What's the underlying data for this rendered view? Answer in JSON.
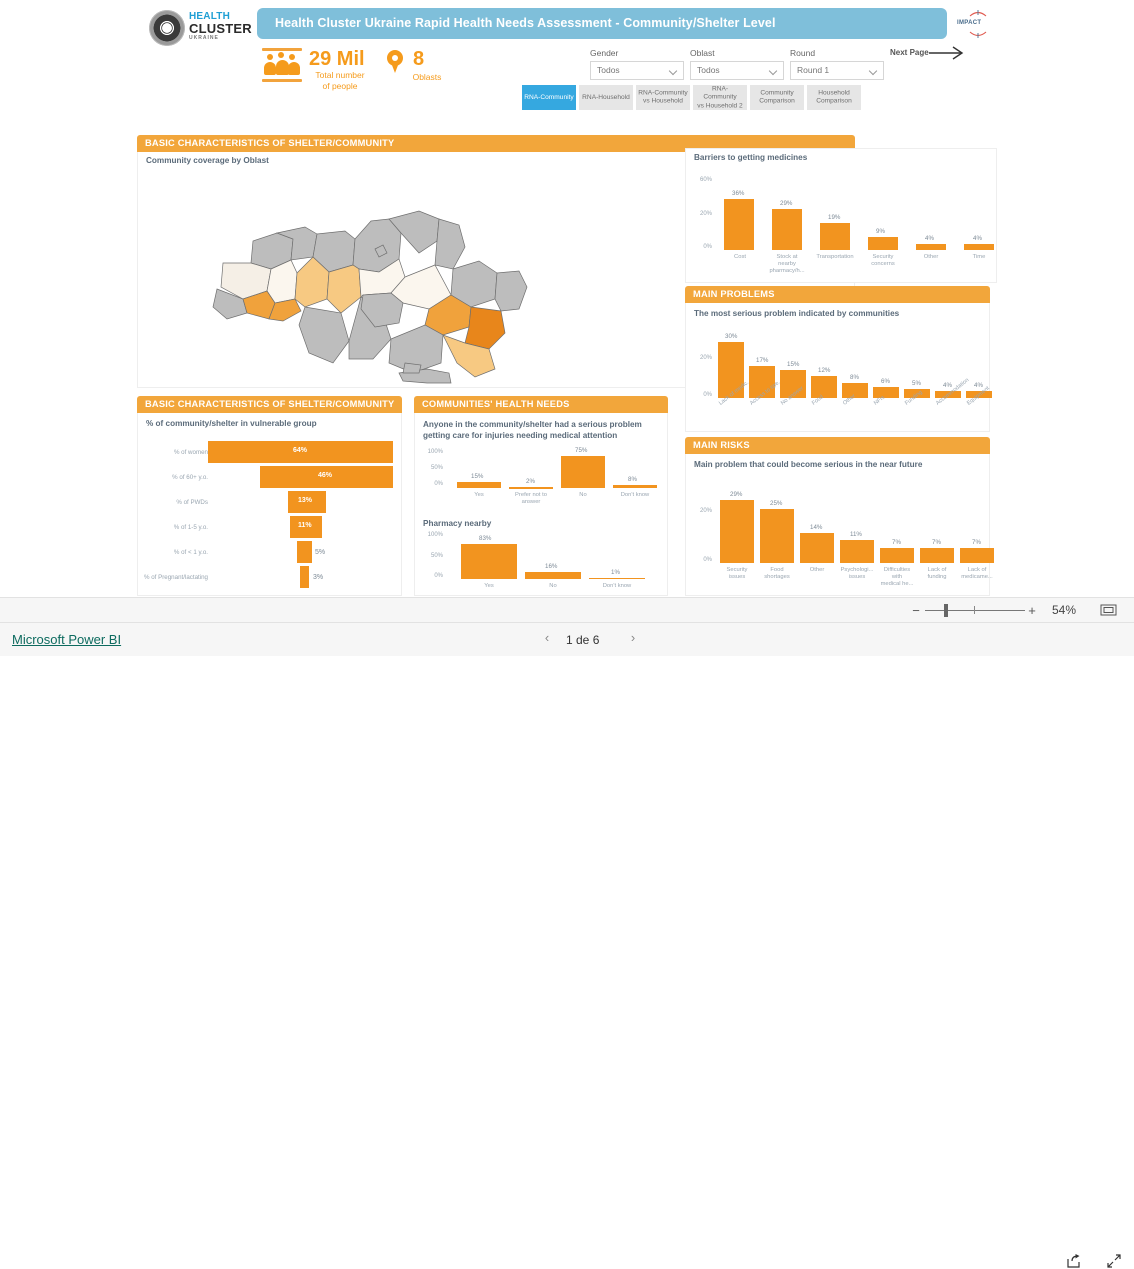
{
  "window": {
    "footer_link": "Microsoft Power BI",
    "page_indicator": "1 de 6",
    "prev_page_icon": "chevron-left-icon",
    "next_page_icon": "chevron-right-icon",
    "zoom_minus": "−",
    "zoom_plus": "+",
    "zoom_level": "54%",
    "fit_icon": "fit-to-page-icon",
    "share_icon": "share-icon",
    "fullscreen_icon": "fullscreen-icon"
  },
  "header": {
    "title": "Health Cluster Ukraine Rapid Health Needs Assessment - Community/Shelter Level",
    "title_bg": "#7fbfda",
    "logo": {
      "line1": "HEALTH",
      "line2": "CLUSTER",
      "line3": "UKRAINE",
      "icon": "health-cluster-sun-logo"
    },
    "partner_logo": "impact-initiatives-logo",
    "next_page_label": "Next Page",
    "next_page_icon": "long-arrow-right-icon"
  },
  "kpis": [
    {
      "value": "29 Mil",
      "label": "Total number\nof people",
      "label_l1": "Total number",
      "label_l2": "of people",
      "icon": "people-group-icon",
      "color": "#F59B1C"
    },
    {
      "value": "8",
      "label": "Oblasts",
      "icon": "map-pin-icon",
      "color": "#F59B1C"
    }
  ],
  "slicers": [
    {
      "label": "Gender",
      "value": "Todos",
      "icon": "chevron-down-icon"
    },
    {
      "label": "Oblast",
      "value": "Todos",
      "icon": "chevron-down-icon"
    },
    {
      "label": "Round",
      "value": "Round 1",
      "icon": "chevron-down-icon"
    }
  ],
  "tabs": [
    {
      "label": "RNA-Community",
      "lines": [
        "RNA-Community"
      ],
      "active": true
    },
    {
      "label": "RNA-Household",
      "lines": [
        "RNA-Household"
      ],
      "active": false
    },
    {
      "label": "RNA-Community vs Household",
      "lines": [
        "RNA-Community",
        "vs Household"
      ],
      "active": false
    },
    {
      "label": "RNA- Community vs Household 2",
      "lines": [
        "RNA- Community",
        "vs Household 2"
      ],
      "active": false
    },
    {
      "label": "Community Comparison",
      "lines": [
        "Community",
        "Comparison"
      ],
      "active": false
    },
    {
      "label": "Household Comparison",
      "lines": [
        "Household",
        "Comparison"
      ],
      "active": false
    }
  ],
  "panels": {
    "map_panel_title": "BASIC CHARACTERISTICS OF SHELTER/COMMUNITY",
    "vulnerable_panel_title": "BASIC CHARACTERISTICS OF SHELTER/COMMUNITY",
    "health_needs_title": "COMMUNITIES' HEALTH NEEDS",
    "main_problems_title": "MAIN PROBLEMS",
    "main_risks_title": "MAIN RISKS",
    "accent": "#F2A63B"
  },
  "chart_data": [
    {
      "id": "community-coverage-map",
      "type": "map",
      "title": "Community coverage by Oblast",
      "region": "Ukraine",
      "legend": "choropleth orange scale",
      "no_data_color": "#BDBDBD",
      "highlight_colors": [
        "#F5EFE6",
        "#FAE3C4",
        "#F7C982",
        "#F0A23C",
        "#E8861B"
      ]
    },
    {
      "id": "barriers-to-getting-medicines",
      "type": "bar",
      "title": "Barriers to getting medicines",
      "categories": [
        "Cost",
        "Stock at nearby pharmacy/h...",
        "Transportation",
        "Security concerns",
        "Other",
        "Time"
      ],
      "category_lines": [
        [
          "Cost"
        ],
        [
          "Stock at",
          "nearby",
          "pharmacy/h..."
        ],
        [
          "Transportation"
        ],
        [
          "Security",
          "concerns"
        ],
        [
          "Other"
        ],
        [
          "Time"
        ]
      ],
      "values": [
        36,
        29,
        19,
        9,
        4,
        4
      ],
      "labels": [
        "36%",
        "29%",
        "19%",
        "9%",
        "4%",
        "4%"
      ],
      "yticks": [
        "60%",
        "20%",
        "0%"
      ],
      "ylim": [
        0,
        60
      ],
      "ylabel": "",
      "xlabel": "",
      "grid": false,
      "bar_color": "#F2941F"
    },
    {
      "id": "most-serious-problem",
      "type": "bar",
      "title": "The most serious problem indicated by communities",
      "categories": [
        "Lack of medic...",
        "Access to spe...",
        "No answer",
        "Food",
        "Other",
        "NFIs",
        "Funding",
        "Accommodation",
        "Equipment"
      ],
      "values": [
        30,
        17,
        15,
        12,
        8,
        6,
        5,
        4,
        4
      ],
      "labels": [
        "30%",
        "17%",
        "15%",
        "12%",
        "8%",
        "6%",
        "5%",
        "4%",
        "4%"
      ],
      "yticks": [
        "20%",
        "0%"
      ],
      "ylim": [
        0,
        33
      ],
      "grid": false,
      "bar_color": "#F2941F"
    },
    {
      "id": "main-risk-near-future",
      "type": "bar",
      "title": "Main problem that could become serious in the near future",
      "categories": [
        "Security issues",
        "Food shortages",
        "Other",
        "Psychologi... issues",
        "Difficulties with medical he...",
        "Lack of funding",
        "Lack of medicame..."
      ],
      "category_lines": [
        [
          "Security",
          "issues"
        ],
        [
          "Food",
          "shortages"
        ],
        [
          "Other"
        ],
        [
          "Psychologi...",
          "issues"
        ],
        [
          "Difficulties",
          "with",
          "medical he..."
        ],
        [
          "Lack of",
          "funding"
        ],
        [
          "Lack of",
          "medicame..."
        ]
      ],
      "values": [
        29,
        25,
        14,
        11,
        7,
        7,
        7
      ],
      "labels": [
        "29%",
        "25%",
        "14%",
        "11%",
        "7%",
        "7%",
        "7%"
      ],
      "yticks": [
        "20%",
        "0%"
      ],
      "ylim": [
        0,
        32
      ],
      "grid": false,
      "bar_color": "#F2941F"
    },
    {
      "id": "vulnerable-group",
      "type": "bar",
      "orientation": "horizontal-centered",
      "title": "% of community/shelter in vulnerable group",
      "categories": [
        "% of women",
        "% of 60+ y.o.",
        "% of PWDs",
        "% of 1-5 y.o.",
        "% of < 1 y.o.",
        "% of Pregnant/lactating"
      ],
      "values": [
        64,
        46,
        13,
        11,
        5,
        3
      ],
      "labels": [
        "64%",
        "46%",
        "13%",
        "11%",
        "5%",
        "3%"
      ],
      "xlim": [
        0,
        64
      ],
      "bar_color": "#F2941F"
    },
    {
      "id": "serious-problem-getting-care",
      "type": "bar",
      "title": "Anyone in the community/shelter had a serious problem getting care for injuries needing medical attention",
      "title_l1": "Anyone in the community/shelter had a serious problem",
      "title_l2": "getting care for injuries needing medical attention",
      "categories": [
        "Yes",
        "Prefer not to answer",
        "No",
        "Don't know"
      ],
      "category_lines": [
        [
          "Yes"
        ],
        [
          "Prefer not to",
          "answer"
        ],
        [
          "No"
        ],
        [
          "Don't know"
        ]
      ],
      "values": [
        15,
        2,
        75,
        8
      ],
      "labels": [
        "15%",
        "2%",
        "75%",
        "8%"
      ],
      "yticks": [
        "100%",
        "50%",
        "0%"
      ],
      "ylim": [
        0,
        100
      ],
      "bar_color": "#F2941F"
    },
    {
      "id": "pharmacy-nearby",
      "type": "bar",
      "title": "Pharmacy nearby",
      "categories": [
        "Yes",
        "No",
        "Don't know"
      ],
      "values": [
        83,
        16,
        1
      ],
      "labels": [
        "83%",
        "16%",
        "1%"
      ],
      "yticks": [
        "100%",
        "50%",
        "0%"
      ],
      "ylim": [
        0,
        100
      ],
      "bar_color": "#F2941F"
    }
  ]
}
